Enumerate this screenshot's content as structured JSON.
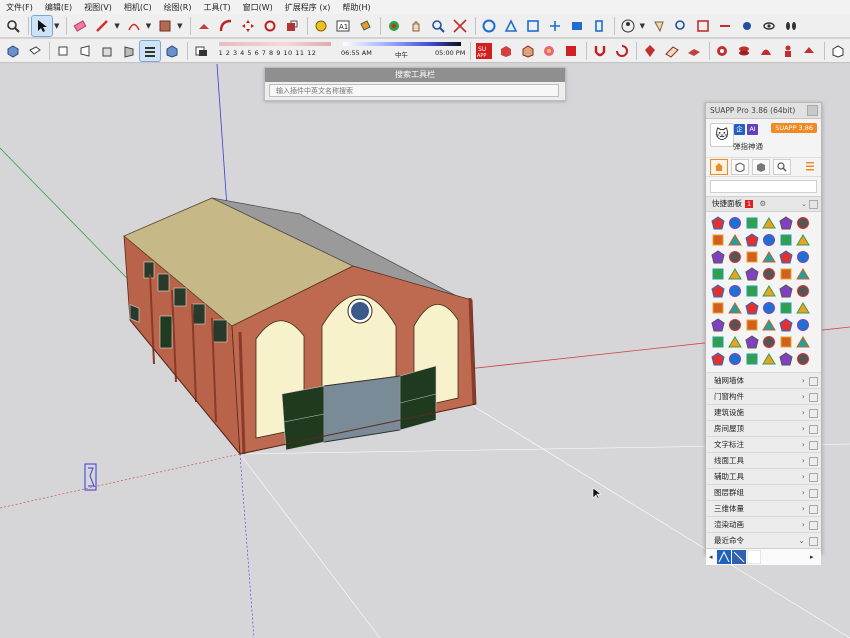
{
  "menu": [
    "文件(F)",
    "编辑(E)",
    "视图(V)",
    "相机(C)",
    "绘图(R)",
    "工具(T)",
    "窗口(W)",
    "扩展程序 (x)",
    "帮助(H)"
  ],
  "shadow_slider": {
    "ticks": "1 2 3 4 5 6 7 8 9 10 11 12"
  },
  "time_slider": {
    "start": "06:55 AM",
    "mid": "中午",
    "end": "05:00 PM"
  },
  "search_toolbar": {
    "title": "搜索工具栏",
    "placeholder": "输入插件中英文名称搜索"
  },
  "suapp": {
    "title": "SUAPP Pro 3.86 (64bit)",
    "user_name": "弹指神通",
    "badge_enterprise": "企",
    "badge_ai": "AI",
    "version_badge": "SUAPP 3.86",
    "quick_panel": {
      "label": "快捷面板",
      "count": "1"
    },
    "categories": [
      "轴网墙体",
      "门窗构件",
      "建筑设施",
      "房间屋顶",
      "文字标注",
      "线面工具",
      "辅助工具",
      "图层群组",
      "三维体量",
      "渲染动画",
      "最近命令"
    ]
  },
  "colors": {
    "accent": "#f08a24",
    "axis_red": "#d04040",
    "axis_green": "#3aa048",
    "axis_blue": "#3b3bd8",
    "brick": "#b8634a",
    "roof": "#c7b888",
    "door_green": "#1f3a1f"
  }
}
